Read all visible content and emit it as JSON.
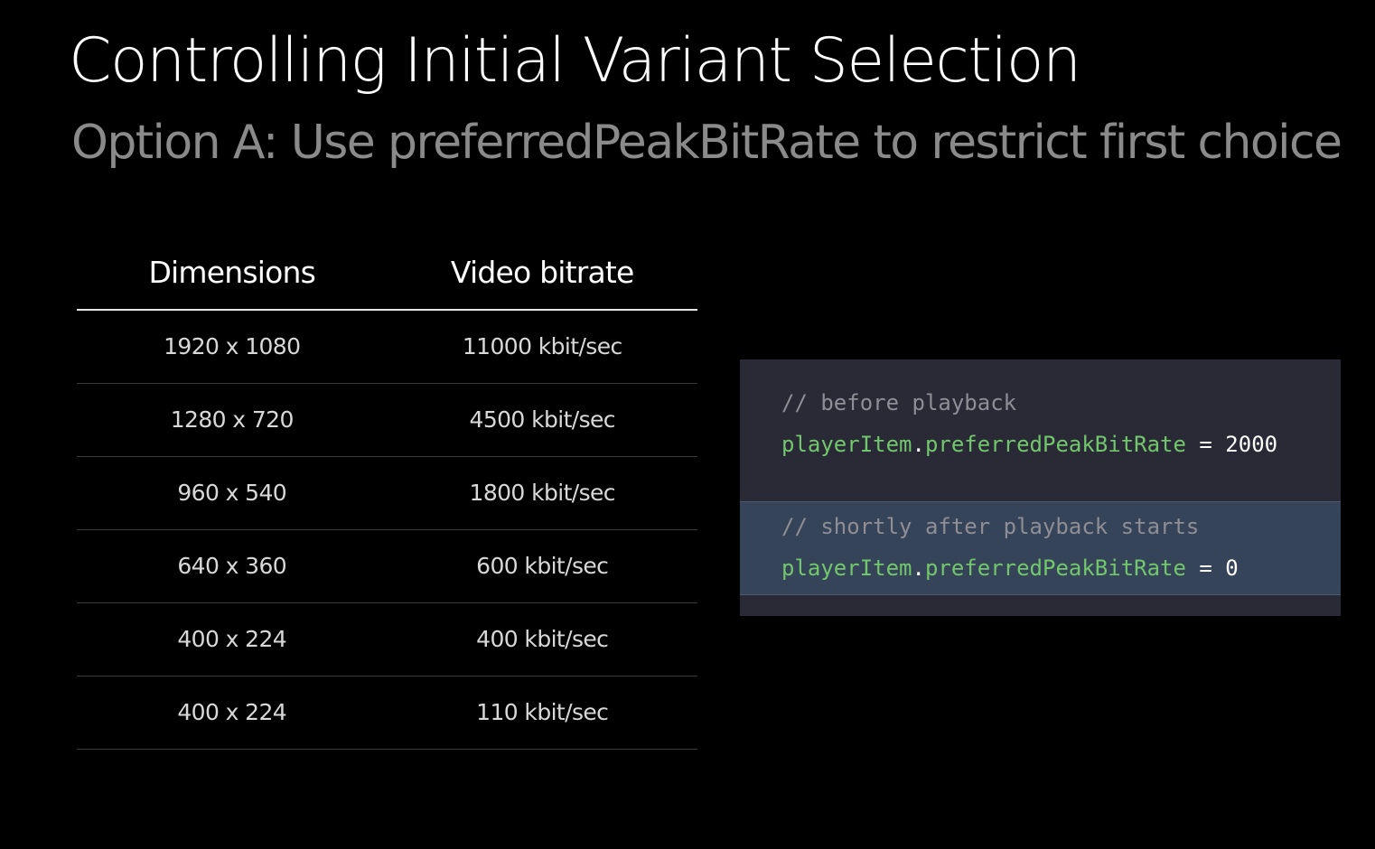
{
  "slide": {
    "title": "Controlling Initial Variant Selection",
    "subtitle": "Option A: Use preferredPeakBitRate to restrict first choice"
  },
  "table": {
    "headers": [
      "Dimensions",
      "Video bitrate"
    ],
    "rows": [
      [
        "1920 x 1080",
        "11000 kbit/sec"
      ],
      [
        "1280 x 720",
        "4500 kbit/sec"
      ],
      [
        "960 x 540",
        "1800 kbit/sec"
      ],
      [
        "640 x 360",
        "600 kbit/sec"
      ],
      [
        "400 x 224",
        "400 kbit/sec"
      ],
      [
        "400 x 224",
        "110 kbit/sec"
      ]
    ]
  },
  "code": {
    "colors": {
      "background": "#2a2a36",
      "highlight": "#354458",
      "identifier": "#72c66c",
      "comment": "#8e8e96"
    },
    "block1": {
      "comment": "// before playback",
      "object": "playerItem",
      "dot": ".",
      "property": "preferredPeakBitRate",
      "op": " = ",
      "value": "2000"
    },
    "block2": {
      "comment": "// shortly after playback starts",
      "object": "playerItem",
      "dot": ".",
      "property": "preferredPeakBitRate",
      "op": " = ",
      "value": "0"
    }
  }
}
